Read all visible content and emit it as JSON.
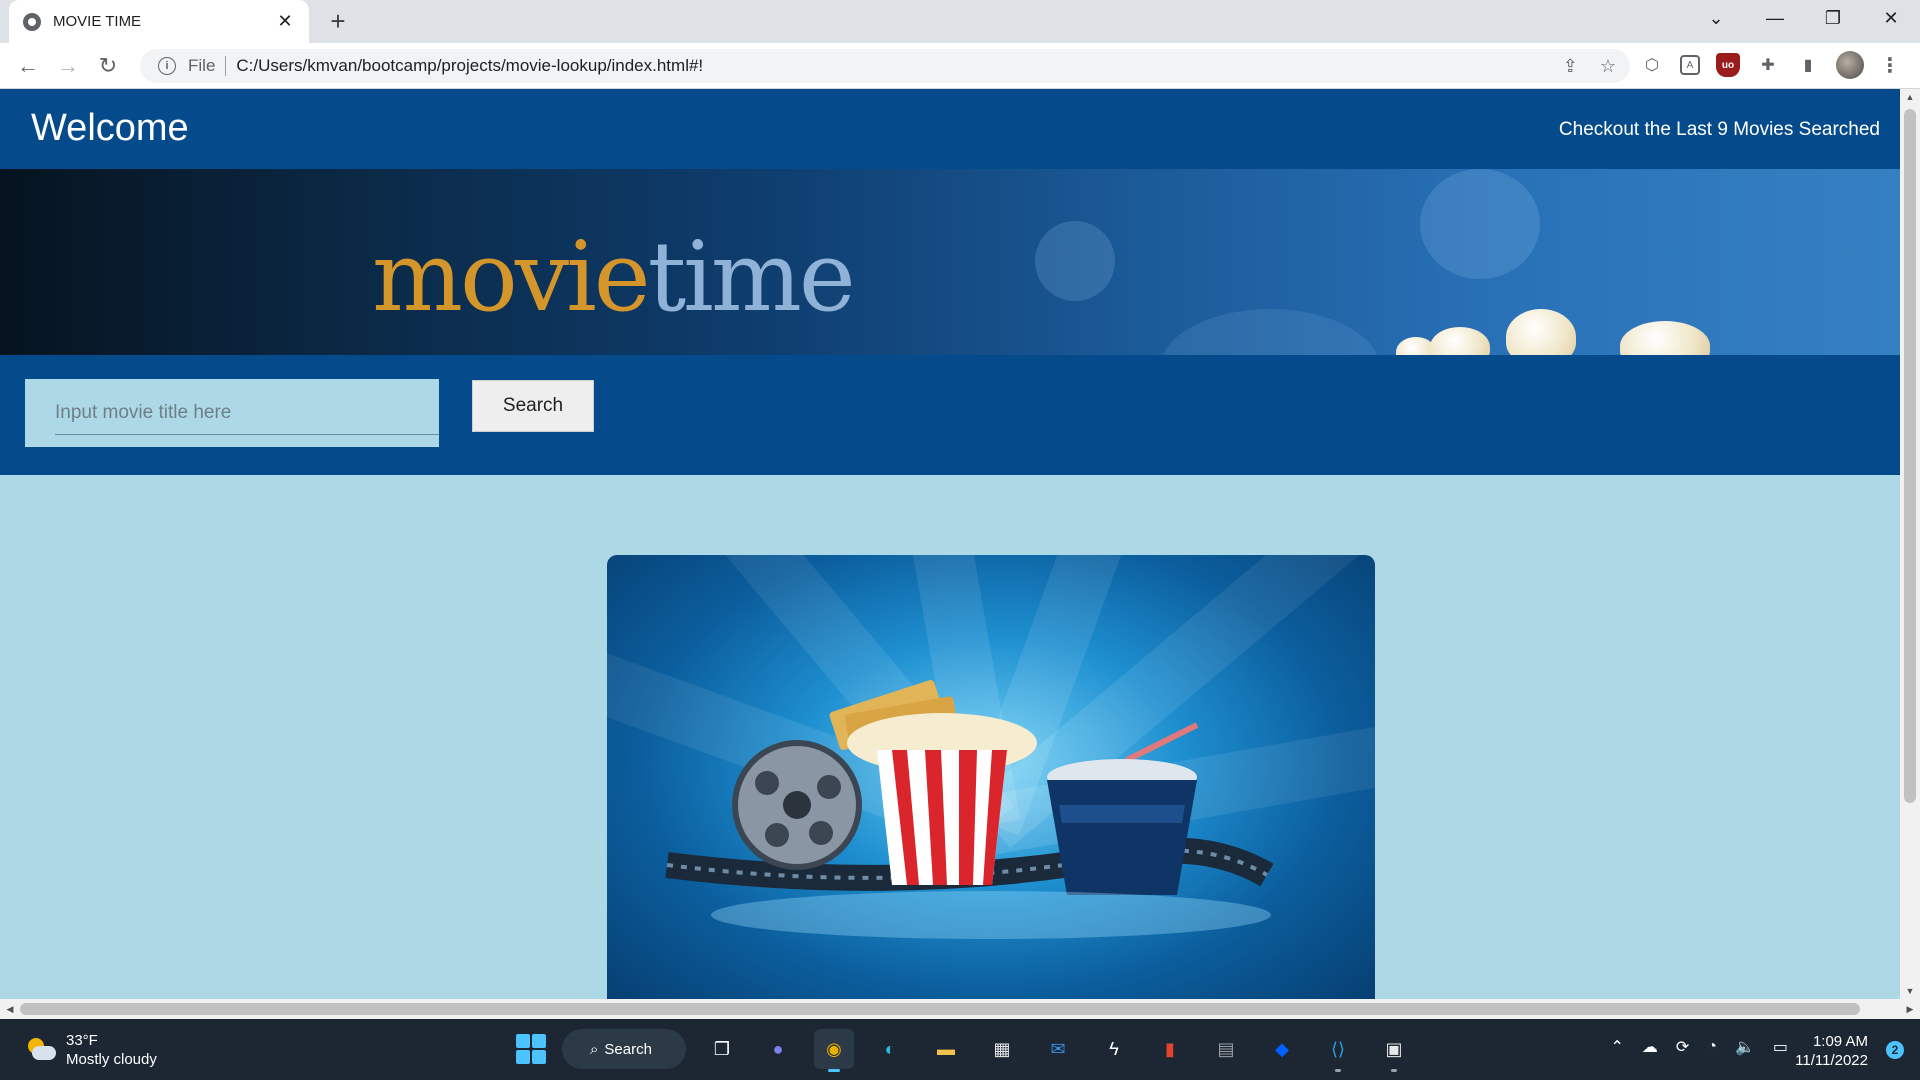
{
  "browser": {
    "tab_title": "MOVIE TIME",
    "tab_close": "✕",
    "new_tab": "+",
    "file_label": "File",
    "url": "C:/Users/kmvan/bootcamp/projects/movie-lookup/index.html#!"
  },
  "page": {
    "header": {
      "welcome": "Welcome",
      "last_searched_link": "Checkout the Last 9 Movies Searched"
    },
    "banner": {
      "logo_part1": "movie",
      "logo_part2": "time"
    },
    "search": {
      "placeholder": "Input movie title here",
      "value": "",
      "button_label": "Search"
    }
  },
  "taskbar": {
    "weather_temp": "33°F",
    "weather_desc": "Mostly cloudy",
    "search_label": "Search",
    "time": "1:09 AM",
    "date": "11/11/2022",
    "notification_count": "2"
  },
  "colors": {
    "header_blue": "#054a8b",
    "page_bg": "#add8e6",
    "logo_gold": "#d4952a",
    "logo_blue": "#8fb2d6"
  }
}
